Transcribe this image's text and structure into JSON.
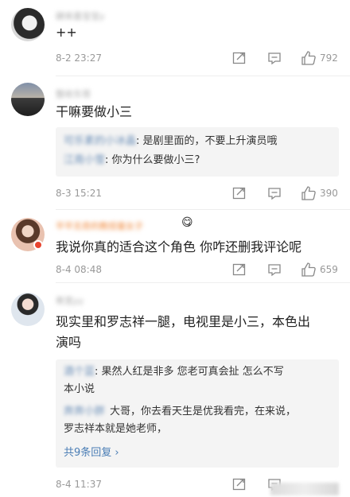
{
  "comments": [
    {
      "username": "肆来喜宝宝y",
      "text": "++",
      "time": "8-2 23:27",
      "likes": "792"
    },
    {
      "username": "整收东哥",
      "text": "干嘛要做小三",
      "time": "8-3 15:21",
      "likes": "390",
      "replies": [
        {
          "name": "可乐素的小冰晶",
          "text": ": 是剧里面的，不要上升演员哦"
        },
        {
          "name": "江南小雪",
          "text": ": 你为什么要做小三?"
        }
      ]
    },
    {
      "username": "平平无奇的教授童女子",
      "emoji": "😋",
      "text": "我说你真的适合这个角色 你咋还删我评论呢",
      "time": "8-4 08:48",
      "likes": "659"
    },
    {
      "username": "希宽yy",
      "text_line1": "现实里和罗志祥一腿，电视里是小三，本色出",
      "text_line2": "演吗",
      "time": "8-4 11:37",
      "replies": [
        {
          "name": "酒个蓝",
          "text_line1": ": 果然人红是非多 您老可真会扯 怎么不写",
          "text_line2": "本小说"
        },
        {
          "name": "奔奔小胖",
          "text_line1": "大哥，你去看天生是优我看完，在来说，",
          "text_line2": "罗志祥本就是她老师，"
        }
      ],
      "more_replies": "共9条回复 ›"
    }
  ],
  "icons": {
    "share": "share-icon",
    "comment": "comment-icon",
    "like": "thumbs-up-icon"
  }
}
